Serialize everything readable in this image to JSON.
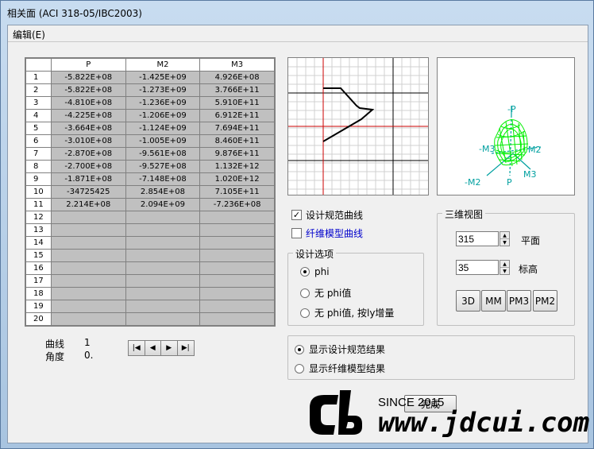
{
  "window": {
    "title": "相关面   (ACI 318-05/IBC2003)"
  },
  "menu": {
    "edit": "编辑(E)"
  },
  "table": {
    "headers": [
      "P",
      "M2",
      "M3"
    ],
    "rows": [
      {
        "n": "1",
        "p": "-5.822E+08",
        "m2": "-1.425E+09",
        "m3": "4.926E+08"
      },
      {
        "n": "2",
        "p": "-5.822E+08",
        "m2": "-1.273E+09",
        "m3": "3.766E+11"
      },
      {
        "n": "3",
        "p": "-4.810E+08",
        "m2": "-1.236E+09",
        "m3": "5.910E+11"
      },
      {
        "n": "4",
        "p": "-4.225E+08",
        "m2": "-1.206E+09",
        "m3": "6.912E+11"
      },
      {
        "n": "5",
        "p": "-3.664E+08",
        "m2": "-1.124E+09",
        "m3": "7.694E+11"
      },
      {
        "n": "6",
        "p": "-3.010E+08",
        "m2": "-1.005E+09",
        "m3": "8.460E+11"
      },
      {
        "n": "7",
        "p": "-2.870E+08",
        "m2": "-9.561E+08",
        "m3": "9.876E+11"
      },
      {
        "n": "8",
        "p": "-2.700E+08",
        "m2": "-9.527E+08",
        "m3": "1.132E+12"
      },
      {
        "n": "9",
        "p": "-1.871E+08",
        "m2": "-7.148E+08",
        "m3": "1.020E+12"
      },
      {
        "n": "10",
        "p": "-34725425",
        "m2": "2.854E+08",
        "m3": "7.105E+11"
      },
      {
        "n": "11",
        "p": "2.214E+08",
        "m2": "2.094E+09",
        "m3": "-7.236E+08"
      },
      {
        "n": "12",
        "p": "",
        "m2": "",
        "m3": ""
      },
      {
        "n": "13",
        "p": "",
        "m2": "",
        "m3": ""
      },
      {
        "n": "14",
        "p": "",
        "m2": "",
        "m3": ""
      },
      {
        "n": "15",
        "p": "",
        "m2": "",
        "m3": ""
      },
      {
        "n": "16",
        "p": "",
        "m2": "",
        "m3": ""
      },
      {
        "n": "17",
        "p": "",
        "m2": "",
        "m3": ""
      },
      {
        "n": "18",
        "p": "",
        "m2": "",
        "m3": ""
      },
      {
        "n": "19",
        "p": "",
        "m2": "",
        "m3": ""
      },
      {
        "n": "20",
        "p": "",
        "m2": "",
        "m3": ""
      }
    ]
  },
  "info": {
    "curve_label": "曲线",
    "curve_value": "1",
    "angle_label": "角度",
    "angle_value": "0."
  },
  "plot3d": {
    "labels": [
      "-P",
      "-M3",
      "M2",
      "M3",
      "-M2",
      "P"
    ]
  },
  "options": {
    "design_curve": {
      "label": "设计规范曲线",
      "checked": true
    },
    "fiber_curve": {
      "label": "纤维模型曲线",
      "checked": false
    },
    "design_group": {
      "title": "设计选项",
      "phi": "phi",
      "no_phi": "无 phi值",
      "no_phi_increase": "无 phi值, 按ly增量",
      "selected": "phi"
    }
  },
  "view3d": {
    "title": "三维视图",
    "plan_value": "315",
    "plan_label": "平面",
    "elev_value": "35",
    "elev_label": "标高",
    "buttons": [
      "3D",
      "MM",
      "PM3",
      "PM2"
    ]
  },
  "results": {
    "show_design": "显示设计规范结果",
    "show_fiber": "显示纤维模型结果",
    "selected": "show_design"
  },
  "done_button": "完成",
  "watermark": {
    "since": "SINCE 2015",
    "site": "www.jdcui.com"
  },
  "colors": {
    "plot_axis": "#cc0000",
    "mesh": "#00ee00",
    "label": "#00a0a0"
  }
}
